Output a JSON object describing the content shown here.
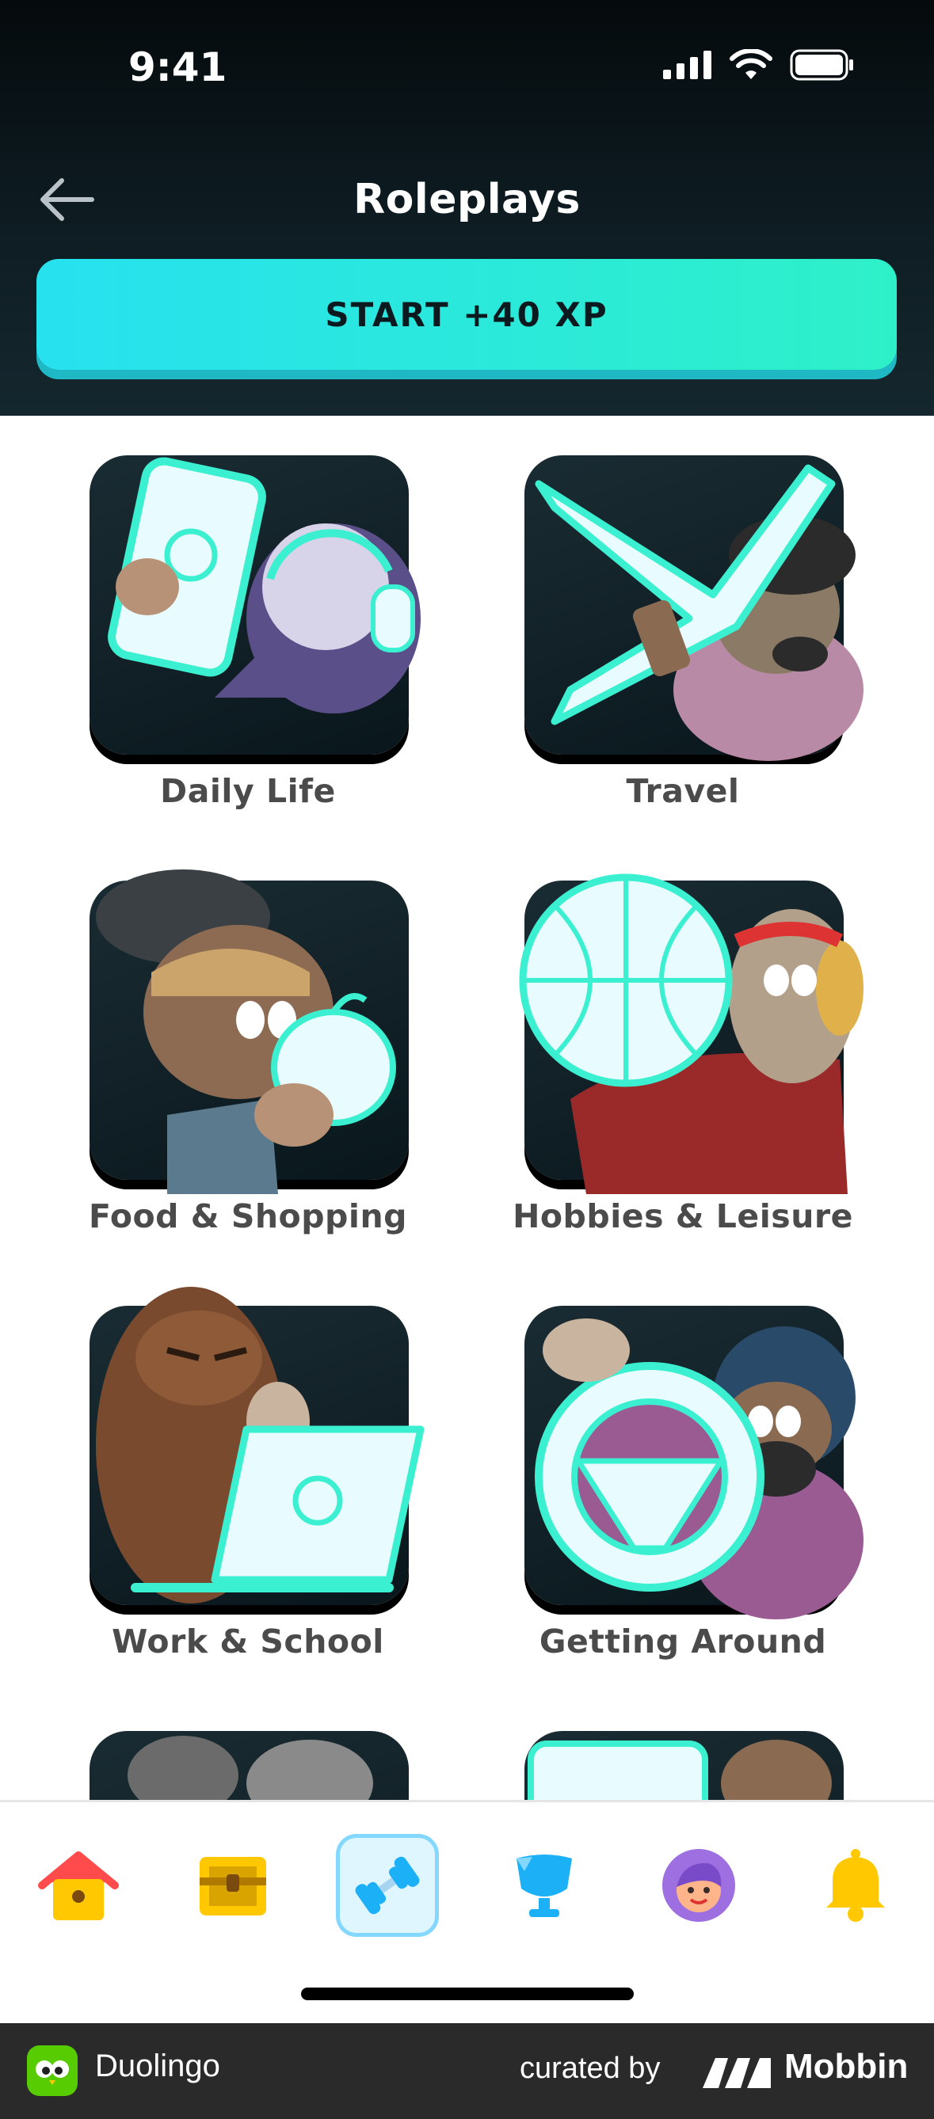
{
  "status_bar": {
    "time": "9:41"
  },
  "header": {
    "title": "Roleplays",
    "start_button": "START +40 XP"
  },
  "categories": [
    {
      "label": "Daily Life"
    },
    {
      "label": "Travel"
    },
    {
      "label": "Food & Shopping"
    },
    {
      "label": "Hobbies & Leisure"
    },
    {
      "label": "Work & School"
    },
    {
      "label": "Getting Around"
    }
  ],
  "nav": {
    "items": [
      {
        "name": "home-icon"
      },
      {
        "name": "treasure-chest-icon"
      },
      {
        "name": "practice-dumbbell-icon",
        "active": true
      },
      {
        "name": "leaderboard-trophy-icon"
      },
      {
        "name": "profile-avatar-icon"
      },
      {
        "name": "notifications-bell-icon"
      }
    ]
  },
  "footer": {
    "brand": "Duolingo",
    "curated_by": "curated by",
    "mobbin": "Mobbin"
  },
  "colors": {
    "accent_start": "#27e1ef",
    "accent_end": "#2ef0c8",
    "header_bg": "#0e1d23",
    "label": "#4b4b4b",
    "nav_active": "#84d8ff"
  }
}
